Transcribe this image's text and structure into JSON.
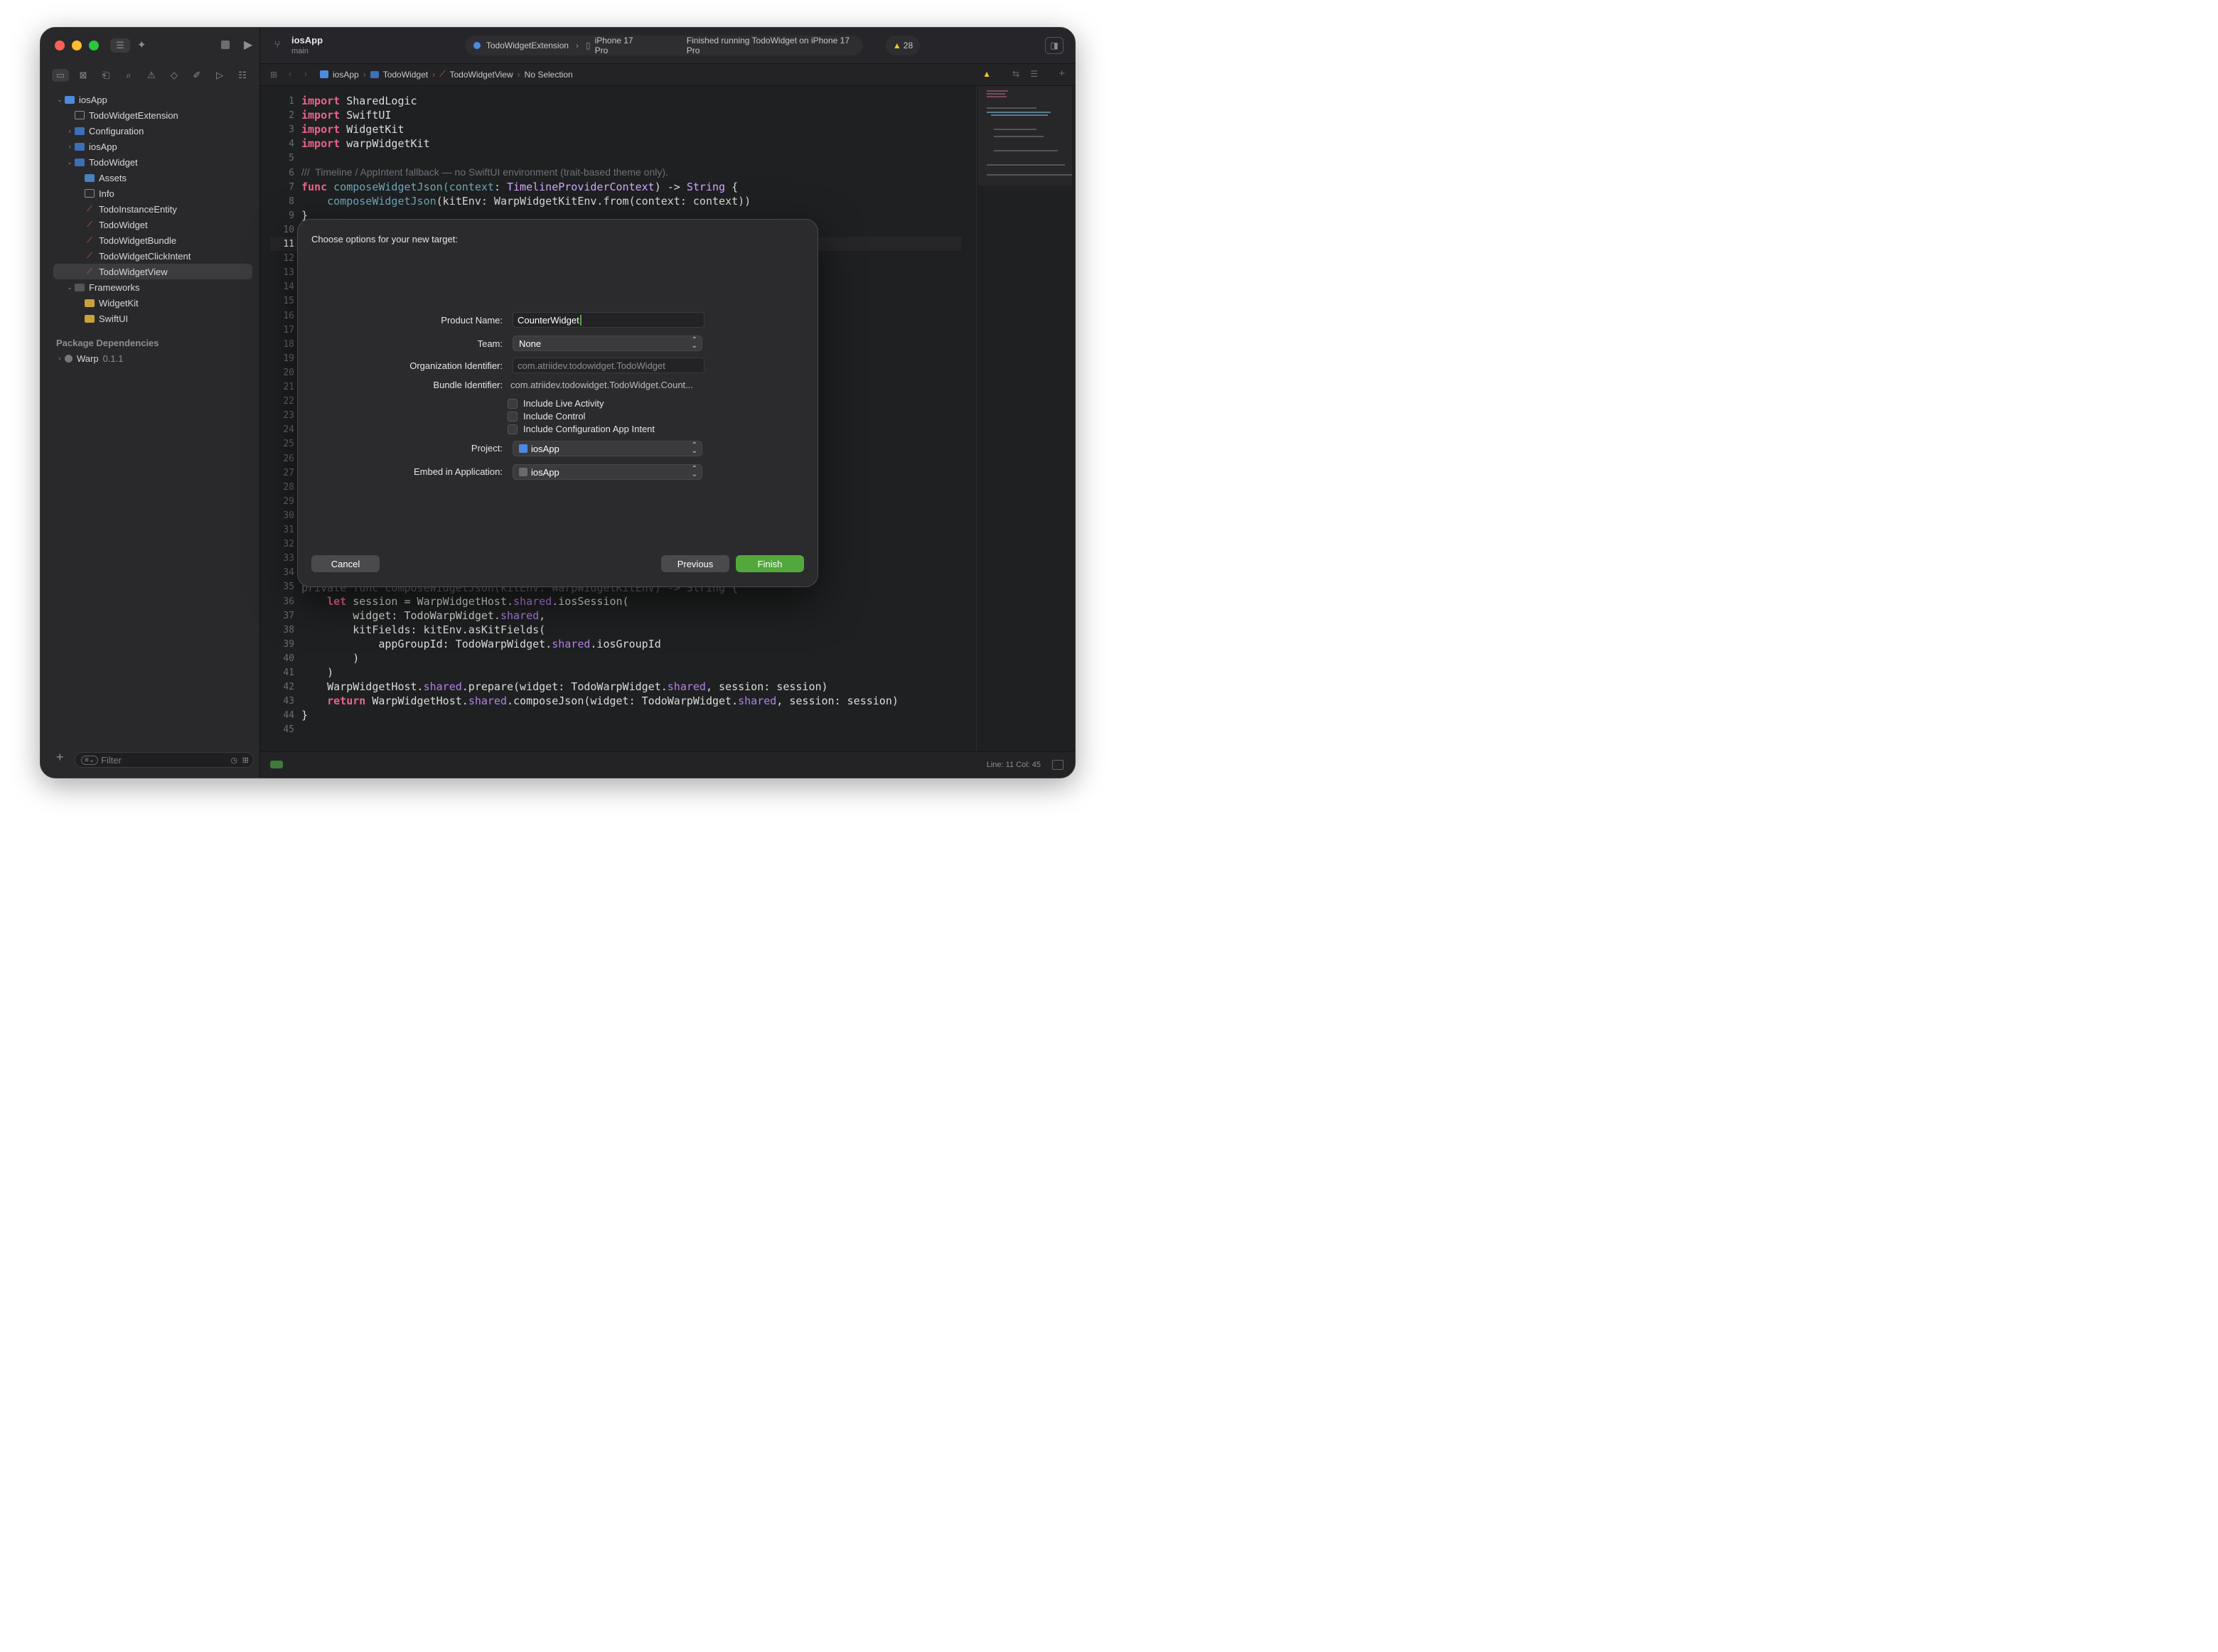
{
  "window": {
    "scheme_title": "iosApp",
    "branch": "main",
    "run_target": "TodoWidgetExtension",
    "device": "iPhone 17 Pro",
    "run_status": "Finished running TodoWidget on iPhone 17 Pro",
    "warning_count": "28"
  },
  "breadcrumb": {
    "items": [
      "iosApp",
      "TodoWidget",
      "TodoWidgetView",
      "No Selection"
    ]
  },
  "navigator": {
    "items": [
      {
        "label": "iosApp"
      },
      {
        "label": "TodoWidgetExtension"
      },
      {
        "label": "Configuration"
      },
      {
        "label": "iosApp"
      },
      {
        "label": "TodoWidget"
      },
      {
        "label": "Assets"
      },
      {
        "label": "Info"
      },
      {
        "label": "TodoInstanceEntity"
      },
      {
        "label": "TodoWidget"
      },
      {
        "label": "TodoWidgetBundle"
      },
      {
        "label": "TodoWidgetClickIntent"
      },
      {
        "label": "TodoWidgetView"
      },
      {
        "label": "Frameworks"
      },
      {
        "label": "WidgetKit"
      },
      {
        "label": "SwiftUI"
      }
    ],
    "package_section": "Package Dependencies",
    "package": {
      "name": "Warp",
      "version": "0.1.1"
    },
    "filter_placeholder": "Filter"
  },
  "editor": {
    "line_numbers": [
      "1",
      "2",
      "3",
      "4",
      "5",
      "6",
      "7",
      "8",
      "9",
      "10",
      "11",
      "12",
      "13",
      "14",
      "15",
      "16",
      "17",
      "18",
      "19",
      "20",
      "21",
      "22",
      "23",
      "24",
      "25",
      "26",
      "27",
      "28",
      "29",
      "30",
      "31",
      "32",
      "33",
      "34",
      "35",
      "36",
      "37",
      "38",
      "39",
      "40",
      "41",
      "42",
      "43",
      "44",
      "45"
    ],
    "code": {
      "l1_kw": "import",
      "l1_rest": " SharedLogic",
      "l2_kw": "import",
      "l2_rest": " SwiftUI",
      "l3_kw": "import",
      "l3_rest": " WidgetKit",
      "l4_kw": "import",
      "l4_rest": " warpWidgetKit",
      "l6": "///  Timeline / AppIntent fallback — no SwiftUI environment (trait-based theme only).",
      "l7_kw": "func",
      "l7_fn": " composeWidgetJson",
      "l7_p": "(context",
      "l7_c": ": ",
      "l7_ty": "TimelineProviderContext",
      "l7_rest": ") -> ",
      "l7_ty2": "String",
      "l7_end": " {",
      "l8_fn": "    composeWidgetJson",
      "l8_rest": "(kitEnv: WarpWidgetKitEnv.from(context: context))",
      "l9": "}",
      "l35": "private func composeWidgetJson(kitEnv: WarpWidgetKitEnv) -> String {",
      "l36_kw": "    let",
      "l36_rest": " session = WarpWidgetHost.",
      "l36_pp": "shared",
      "l36_end": ".iosSession(",
      "l37_a": "        widget: TodoWarpWidget.",
      "l37_pp": "shared",
      "l37_end": ",",
      "l38": "        kitFields: kitEnv.asKitFields(",
      "l39_a": "            appGroupId: TodoWarpWidget.",
      "l39_pp": "shared",
      "l39_end": ".iosGroupId",
      "l40": "        )",
      "l41": "    )",
      "l42_a": "    WarpWidgetHost.",
      "l42_pp": "shared",
      "l42_b": ".prepare(widget: TodoWarpWidget.",
      "l42_pp2": "shared",
      "l42_end": ", session: session)",
      "l43_kw": "    return",
      "l43_a": " WarpWidgetHost.",
      "l43_pp": "shared",
      "l43_b": ".composeJson(widget: TodoWarpWidget.",
      "l43_pp2": "shared",
      "l43_end": ", session: session)",
      "l44": "}"
    }
  },
  "status": {
    "cursor": "Line: 11  Col: 45"
  },
  "dialog": {
    "title": "Choose options for your new target:",
    "product_name_label": "Product Name:",
    "product_name_value": "CounterWidget",
    "team_label": "Team:",
    "team_value": "None",
    "org_label": "Organization Identifier:",
    "org_value": "com.atriidev.todowidget.TodoWidget",
    "bundle_label": "Bundle Identifier:",
    "bundle_value": "com.atriidev.todowidget.TodoWidget.Count...",
    "chk_live": "Include Live Activity",
    "chk_control": "Include Control",
    "chk_config": "Include Configuration App Intent",
    "project_label": "Project:",
    "project_value": "iosApp",
    "embed_label": "Embed in Application:",
    "embed_value": "iosApp",
    "cancel": "Cancel",
    "previous": "Previous",
    "finish": "Finish"
  },
  "colors": {
    "accent_finish": "#53a83b",
    "keyword": "#e9648c",
    "warning": "#f4c430"
  }
}
